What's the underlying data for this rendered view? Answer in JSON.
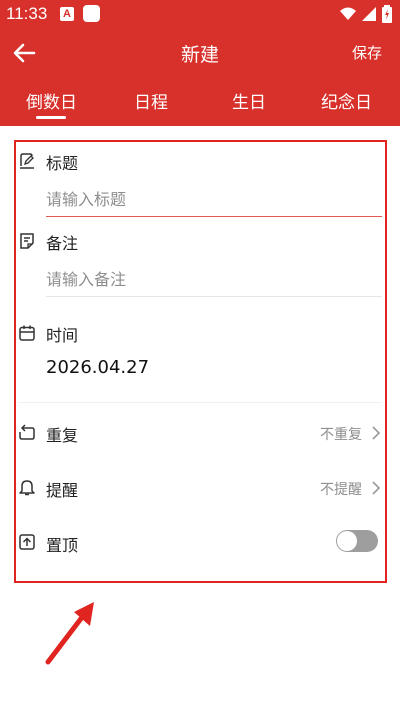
{
  "status_bar": {
    "time": "11:33",
    "notif_letter": "A"
  },
  "app_bar": {
    "title": "新建",
    "save_label": "保存"
  },
  "tabs": [
    {
      "label": "倒数日",
      "active": true
    },
    {
      "label": "日程",
      "active": false
    },
    {
      "label": "生日",
      "active": false
    },
    {
      "label": "纪念日",
      "active": false
    }
  ],
  "form": {
    "title_label": "标题",
    "title_placeholder": "请输入标题",
    "note_label": "备注",
    "note_placeholder": "请输入备注",
    "time_label": "时间",
    "time_value": "2026.04.27",
    "repeat_label": "重复",
    "repeat_value": "不重复",
    "remind_label": "提醒",
    "remind_value": "不提醒",
    "pin_label": "置顶",
    "pin_enabled": false
  },
  "colors": {
    "primary": "#d8302a",
    "annotation": "#e0241f",
    "toggle_off": "#9e9e9e"
  }
}
